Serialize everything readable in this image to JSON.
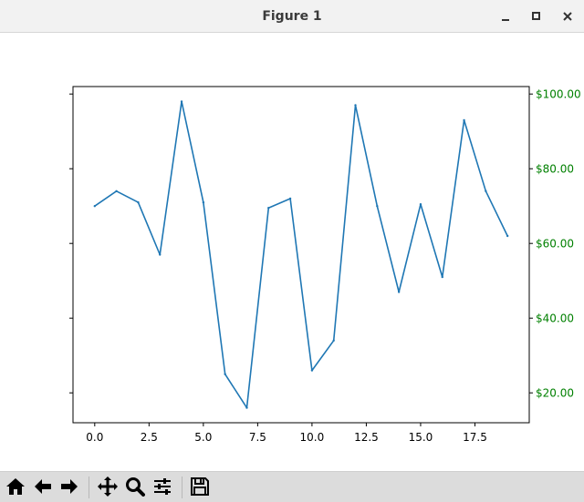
{
  "window": {
    "title": "Figure 1",
    "controls": [
      "minimize-icon",
      "maximize-icon",
      "close-icon"
    ]
  },
  "toolbar": {
    "buttons": [
      "home-icon",
      "back-icon",
      "forward-icon",
      "pan-icon",
      "zoom-icon",
      "configure-subplots-icon",
      "save-icon"
    ]
  },
  "colors": {
    "line": "#1f77b4",
    "right_axis": "#008000"
  },
  "chart_data": {
    "type": "line",
    "x": [
      0,
      1,
      2,
      3,
      4,
      5,
      6,
      7,
      8,
      9,
      10,
      11,
      12,
      13,
      14,
      15,
      16,
      17,
      18,
      19
    ],
    "series": [
      {
        "values": [
          70.0,
          74.0,
          71.0,
          57.0,
          98.0,
          71.0,
          25.0,
          16.0,
          69.5,
          72.0,
          26.0,
          34.0,
          97.0,
          70.0,
          47.0,
          70.5,
          51.0,
          93.0,
          74.0,
          62.0
        ]
      }
    ],
    "xlim": [
      -1.0,
      20.0
    ],
    "ylim": [
      12.0,
      102.0
    ],
    "x_ticks": [
      "0.0",
      "2.5",
      "5.0",
      "7.5",
      "10.0",
      "12.5",
      "15.0",
      "17.5"
    ],
    "x_tick_values": [
      0,
      2.5,
      5,
      7.5,
      10,
      12.5,
      15,
      17.5
    ],
    "right_ticks": [
      "$20.00",
      "$40.00",
      "$60.00",
      "$80.00",
      "$100.00"
    ],
    "right_tick_values": [
      20,
      40,
      60,
      80,
      100
    ],
    "left_tick_values": [
      20,
      40,
      60,
      80,
      100
    ],
    "grid": false
  }
}
